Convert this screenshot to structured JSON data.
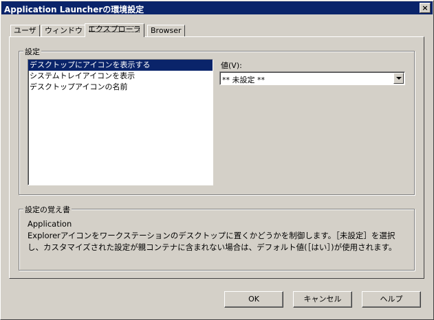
{
  "window": {
    "title": "Application Launcherの環境設定",
    "close_label": "×"
  },
  "tabs": [
    {
      "label": "ユーザ",
      "active": false
    },
    {
      "label": "ウィンドウ",
      "active": false
    },
    {
      "label": "エクスプローラ",
      "active": true
    },
    {
      "label": "Browser",
      "active": false
    }
  ],
  "settings_group": {
    "legend": "設定",
    "list_items": [
      {
        "label": "デスクトップにアイコンを表示する",
        "selected": true
      },
      {
        "label": "システムトレイアイコンを表示",
        "selected": false
      },
      {
        "label": "デスクトップアイコンの名前",
        "selected": false
      }
    ],
    "value_label": "値(V):",
    "value_selected": "** 未設定 **"
  },
  "memo_group": {
    "legend": "設定の覚え書",
    "heading": "Application",
    "text": "Explorerアイコンをワークステーションのデスクトップに置くかどうかを制御します。［未設定］を選択し、カスタマイズされた設定が親コンテナに含まれない場合は、デフォルト値(［はい］)が使用されます。"
  },
  "buttons": {
    "ok": "OK",
    "cancel": "キャンセル",
    "help": "ヘルプ"
  },
  "colors": {
    "titlebar": "#0a246a",
    "selection": "#0a246a",
    "face": "#d4d0c8"
  }
}
